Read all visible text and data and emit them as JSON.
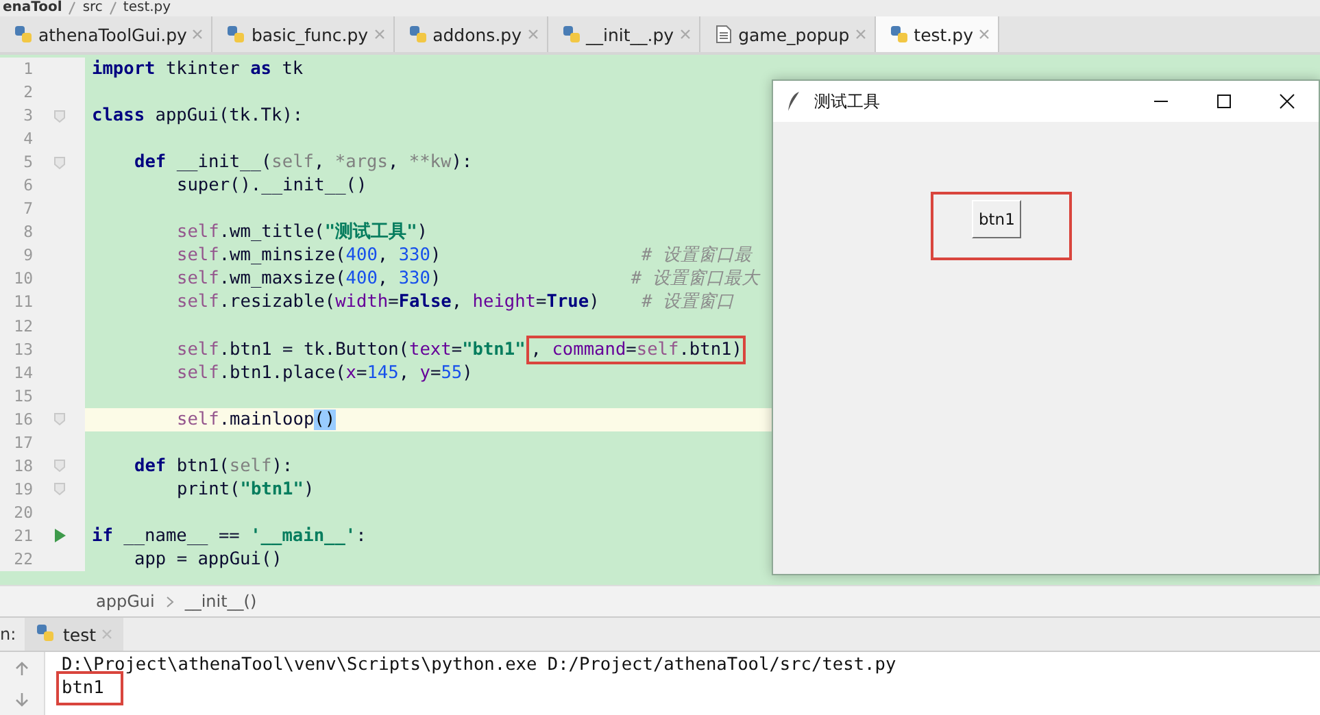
{
  "path_bar": [
    "enaTool",
    "src",
    "test.py"
  ],
  "tabs": [
    {
      "label": "athenaToolGui.py",
      "kind": "python",
      "selected": false
    },
    {
      "label": "basic_func.py",
      "kind": "python",
      "selected": false
    },
    {
      "label": "addons.py",
      "kind": "python",
      "selected": false
    },
    {
      "label": "__init__.py",
      "kind": "python",
      "selected": false
    },
    {
      "label": "game_popup",
      "kind": "text",
      "selected": false
    },
    {
      "label": "test.py",
      "kind": "python",
      "selected": true
    }
  ],
  "editor": {
    "lines": [
      {
        "number": "1",
        "current": false,
        "fold": false,
        "run": false,
        "tokens": [
          {
            "kind": "keyword",
            "text": "import"
          },
          {
            "kind": "plain",
            "text": " tkinter "
          },
          {
            "kind": "keyword",
            "text": "as"
          },
          {
            "kind": "plain",
            "text": " tk"
          }
        ]
      },
      {
        "number": "2",
        "current": false,
        "fold": false,
        "run": false
      },
      {
        "number": "3",
        "current": false,
        "fold": true,
        "run": false,
        "tokens": [
          {
            "kind": "keyword",
            "text": "class"
          },
          {
            "kind": "plain",
            "text": " appGui(tk.Tk):"
          }
        ],
        "children": [
          {
            "number": "4",
            "current": false,
            "fold": false,
            "run": false
          },
          {
            "number": "5",
            "current": false,
            "fold": true,
            "run": false,
            "tokens": [
              {
                "kind": "keyword",
                "text": "def"
              },
              {
                "kind": "plain",
                "text": " __init__("
              },
              {
                "kind": "unused",
                "text": "self"
              },
              {
                "kind": "plain",
                "text": ", "
              },
              {
                "kind": "unused",
                "text": "*args"
              },
              {
                "kind": "plain",
                "text": ", "
              },
              {
                "kind": "unused",
                "text": "**kw"
              },
              {
                "kind": "plain",
                "text": "):"
              }
            ],
            "children": [
              {
                "number": "6",
                "current": false,
                "fold": false,
                "run": false,
                "tokens": [
                  {
                    "kind": "plain",
                    "text": "super().__init__()"
                  }
                ]
              },
              {
                "number": "7",
                "current": false,
                "fold": false,
                "run": false
              },
              {
                "number": "8",
                "current": false,
                "fold": false,
                "run": false,
                "tokens": [
                  {
                    "kind": "self",
                    "text": "self"
                  },
                  {
                    "kind": "plain",
                    "text": ".wm_title("
                  },
                  {
                    "kind": "string",
                    "text": "\"测试工具\""
                  },
                  {
                    "kind": "plain",
                    "text": ")"
                  }
                ]
              },
              {
                "number": "9",
                "current": false,
                "fold": false,
                "run": false,
                "tokens": [
                  {
                    "kind": "self",
                    "text": "self"
                  },
                  {
                    "kind": "plain",
                    "text": ".wm_minsize("
                  },
                  {
                    "kind": "number",
                    "text": "400"
                  },
                  {
                    "kind": "plain",
                    "text": ", "
                  },
                  {
                    "kind": "number",
                    "text": "330"
                  },
                  {
                    "kind": "plain",
                    "text": ")                   "
                  },
                  {
                    "kind": "comment",
                    "text": "# 设置窗口最"
                  }
                ]
              },
              {
                "number": "10",
                "current": false,
                "fold": false,
                "run": false,
                "tokens": [
                  {
                    "kind": "self",
                    "text": "self"
                  },
                  {
                    "kind": "plain",
                    "text": ".wm_maxsize("
                  },
                  {
                    "kind": "number",
                    "text": "400"
                  },
                  {
                    "kind": "plain",
                    "text": ", "
                  },
                  {
                    "kind": "number",
                    "text": "330"
                  },
                  {
                    "kind": "plain",
                    "text": ")                  "
                  },
                  {
                    "kind": "comment",
                    "text": "# 设置窗口最大"
                  }
                ]
              },
              {
                "number": "11",
                "current": false,
                "fold": false,
                "run": false,
                "tokens": [
                  {
                    "kind": "self",
                    "text": "self"
                  },
                  {
                    "kind": "plain",
                    "text": ".resizable("
                  },
                  {
                    "kind": "param",
                    "text": "width"
                  },
                  {
                    "kind": "plain",
                    "text": "="
                  },
                  {
                    "kind": "keyword",
                    "text": "False"
                  },
                  {
                    "kind": "plain",
                    "text": ", "
                  },
                  {
                    "kind": "param",
                    "text": "height"
                  },
                  {
                    "kind": "plain",
                    "text": "="
                  },
                  {
                    "kind": "keyword",
                    "text": "True"
                  },
                  {
                    "kind": "plain",
                    "text": ")    "
                  },
                  {
                    "kind": "comment",
                    "text": "# 设置窗口"
                  }
                ]
              },
              {
                "number": "12",
                "current": false,
                "fold": false,
                "run": false
              },
              {
                "number": "13",
                "current": false,
                "fold": false,
                "run": false,
                "tokens": [
                  {
                    "kind": "self",
                    "text": "self"
                  },
                  {
                    "kind": "plain",
                    "text": ".btn1 = tk.Button("
                  },
                  {
                    "kind": "param",
                    "text": "text"
                  },
                  {
                    "kind": "plain",
                    "text": "="
                  },
                  {
                    "kind": "string",
                    "text": "\"btn1\""
                  },
                  {
                    "kind": "group",
                    "boxed": true,
                    "tokens": [
                      {
                        "kind": "plain",
                        "text": ", "
                      },
                      {
                        "kind": "param",
                        "text": "command"
                      },
                      {
                        "kind": "plain",
                        "text": "="
                      },
                      {
                        "kind": "self",
                        "text": "self"
                      },
                      {
                        "kind": "plain",
                        "text": ".btn1)"
                      }
                    ]
                  }
                ]
              },
              {
                "number": "14",
                "current": false,
                "fold": false,
                "run": false,
                "tokens": [
                  {
                    "kind": "self",
                    "text": "self"
                  },
                  {
                    "kind": "plain",
                    "text": ".btn1.place("
                  },
                  {
                    "kind": "param",
                    "text": "x"
                  },
                  {
                    "kind": "plain",
                    "text": "="
                  },
                  {
                    "kind": "number",
                    "text": "145"
                  },
                  {
                    "kind": "plain",
                    "text": ", "
                  },
                  {
                    "kind": "param",
                    "text": "y"
                  },
                  {
                    "kind": "plain",
                    "text": "="
                  },
                  {
                    "kind": "number",
                    "text": "55"
                  },
                  {
                    "kind": "plain",
                    "text": ")"
                  }
                ]
              },
              {
                "number": "15",
                "current": false,
                "fold": false,
                "run": false
              },
              {
                "number": "16",
                "current": true,
                "fold": true,
                "run": false,
                "tokens": [
                  {
                    "kind": "self",
                    "text": "self"
                  },
                  {
                    "kind": "plain",
                    "text": ".mainloop"
                  },
                  {
                    "kind": "brace_match",
                    "text": "()"
                  }
                ]
              }
            ]
          },
          {
            "number": "17",
            "current": false,
            "fold": false,
            "run": false
          },
          {
            "number": "18",
            "current": false,
            "fold": true,
            "run": false,
            "tokens": [
              {
                "kind": "keyword",
                "text": "def"
              },
              {
                "kind": "plain",
                "text": " btn1("
              },
              {
                "kind": "unused",
                "text": "self"
              },
              {
                "kind": "plain",
                "text": "):"
              }
            ],
            "children": [
              {
                "number": "19",
                "current": false,
                "fold": true,
                "run": false,
                "tokens": [
                  {
                    "kind": "plain",
                    "text": "print("
                  },
                  {
                    "kind": "string",
                    "text": "\"btn1\""
                  },
                  {
                    "kind": "plain",
                    "text": ")"
                  }
                ]
              }
            ]
          }
        ]
      },
      {
        "number": "20",
        "current": false,
        "fold": false,
        "run": false
      },
      {
        "number": "21",
        "current": false,
        "fold": false,
        "run": true,
        "tokens": [
          {
            "kind": "keyword",
            "text": "if"
          },
          {
            "kind": "plain",
            "text": " __name__ == "
          },
          {
            "kind": "string",
            "text": "'__main__'"
          },
          {
            "kind": "plain",
            "text": ":"
          }
        ],
        "children": [
          {
            "number": "22",
            "current": false,
            "fold": false,
            "run": false,
            "tokens": [
              {
                "kind": "plain",
                "text": "app = appGui()"
              }
            ]
          }
        ]
      }
    ]
  },
  "breadcrumbs": [
    "appGui",
    "__init__()"
  ],
  "run_panel": {
    "label": "n:",
    "tab": {
      "label": "test",
      "selected": true
    },
    "output": [
      {
        "text": "D:\\Project\\athenaTool\\venv\\Scripts\\python.exe D:/Project/athenaTool/src/test.py",
        "boxed": false
      },
      {
        "text": "btn1",
        "boxed": true
      }
    ]
  },
  "app_window": {
    "title": "测试工具",
    "button": {
      "text": "btn1",
      "boxed": true
    }
  }
}
